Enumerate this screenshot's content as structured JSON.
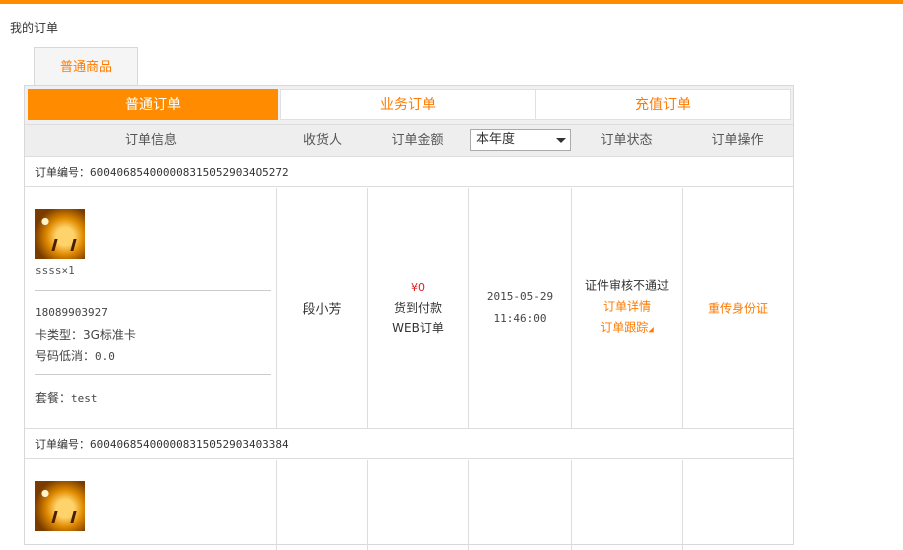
{
  "breadcrumb": "我的订单",
  "outer_tab": "普通商品",
  "sub_tabs": [
    "普通订单",
    "业务订单",
    "充值订单"
  ],
  "headers": {
    "info": "订单信息",
    "receiver": "收货人",
    "amount": "订单金额",
    "filter_value": "本年度",
    "status": "订单状态",
    "ops": "订单操作"
  },
  "orders": [
    {
      "order_label": "订单编号：",
      "order_no": "6004068540000083150529034O5272",
      "product": "ssss×1",
      "phone": "18089903927",
      "card_type": "卡类型：3G标准卡",
      "min_label": "号码低消：",
      "min_value": "0.0",
      "plan_label": "套餐：",
      "plan_value": "test",
      "receiver": "段小芳",
      "price": "¥0",
      "payment": "货到付款",
      "channel": "WEB订单",
      "date": "2015-05-29",
      "time": "11:46:00",
      "status": "证件审核不通过",
      "detail_link": "订单详情",
      "track_link": "订单跟踪",
      "action": "重传身份证"
    },
    {
      "order_label": "订单编号：",
      "order_no": "600406854000008315052903403384"
    }
  ],
  "colors": {
    "accent": "#ff8c00",
    "link": "#ff7a00",
    "price": "#e02020"
  }
}
